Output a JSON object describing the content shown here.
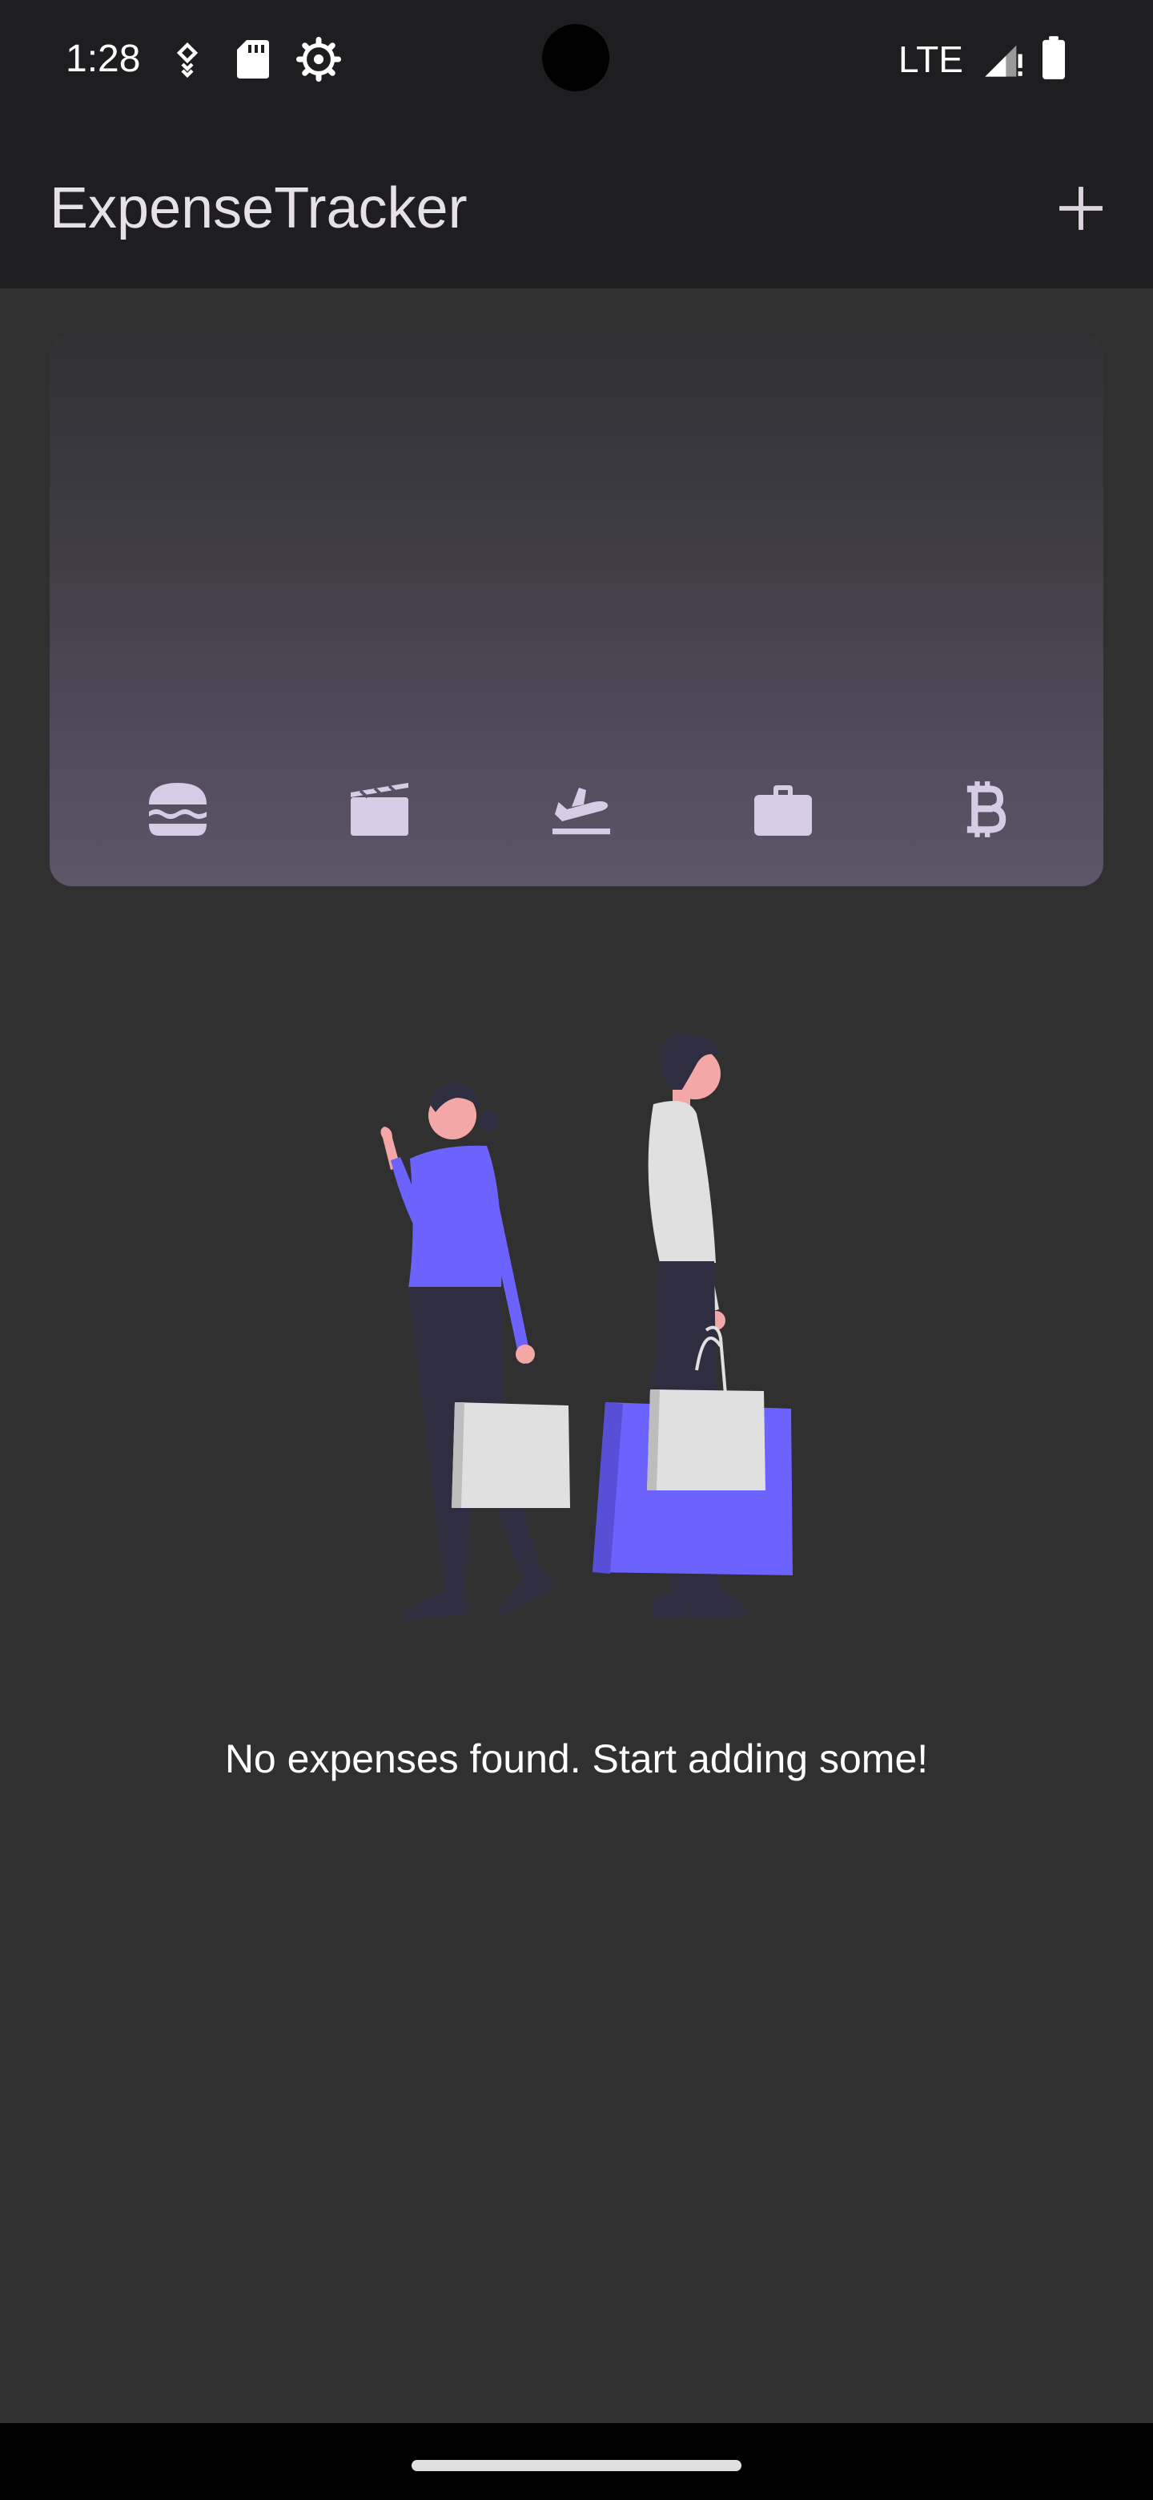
{
  "status_bar": {
    "time": "1:28",
    "network": "LTE",
    "icons": [
      "location-icon",
      "sd-card-icon",
      "settings-gear-icon",
      "signal-icon",
      "battery-icon"
    ]
  },
  "app_bar": {
    "title": "ExpenseTracker",
    "add_icon": "plus-icon"
  },
  "chart_card": {
    "categories": [
      {
        "name": "food",
        "icon": "burger-icon"
      },
      {
        "name": "leisure",
        "icon": "movie-clapper-icon"
      },
      {
        "name": "travel",
        "icon": "airplane-icon"
      },
      {
        "name": "work",
        "icon": "briefcase-icon"
      },
      {
        "name": "crypto",
        "icon": "bitcoin-icon"
      }
    ],
    "icon_color": "#d7cce5"
  },
  "empty_state": {
    "message": "No expenses found. Start adding some!",
    "accent_color": "#6c63ff"
  }
}
